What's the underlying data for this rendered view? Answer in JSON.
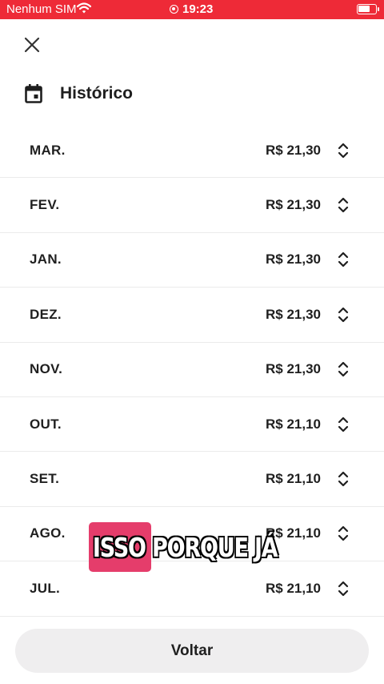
{
  "status_bar": {
    "carrier": "Nenhum SIM",
    "time": "19:23",
    "background_color": "#ee2a37"
  },
  "header": {
    "close_icon": "close-icon",
    "calendar_icon": "calendar-icon",
    "title": "Histórico"
  },
  "history": [
    {
      "month": "MAR.",
      "amount": "R$ 21,30"
    },
    {
      "month": "FEV.",
      "amount": "R$ 21,30"
    },
    {
      "month": "JAN.",
      "amount": "R$ 21,30"
    },
    {
      "month": "DEZ.",
      "amount": "R$ 21,30"
    },
    {
      "month": "NOV.",
      "amount": "R$ 21,30"
    },
    {
      "month": "OUT.",
      "amount": "R$ 21,10"
    },
    {
      "month": "SET.",
      "amount": "R$ 21,10"
    },
    {
      "month": "AGO.",
      "amount": "R$ 21,10"
    },
    {
      "month": "JUL.",
      "amount": "R$ 21,10"
    }
  ],
  "footer": {
    "back_label": "Voltar"
  },
  "caption": {
    "text": "ISSO PORQUE JÁ",
    "highlight_color": "#e53d6b"
  }
}
